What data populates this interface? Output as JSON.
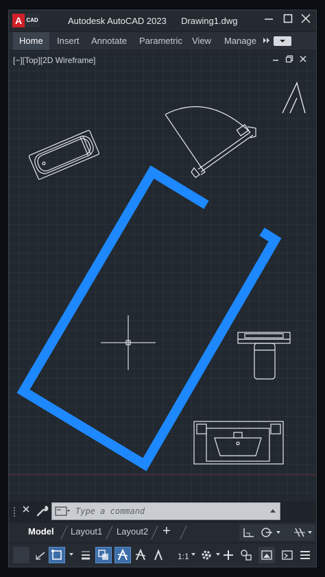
{
  "app": {
    "logo_letter": "A",
    "logo_text": "CAD",
    "title": "Autodesk AutoCAD 2023",
    "document": "Drawing1.dwg",
    "accent_color": "#1e88ff"
  },
  "ribbon": {
    "tabs": [
      {
        "label": "Home",
        "active": true
      },
      {
        "label": "Insert",
        "active": false
      },
      {
        "label": "Annotate",
        "active": false
      },
      {
        "label": "Parametric",
        "active": false
      },
      {
        "label": "View",
        "active": false
      },
      {
        "label": "Manage",
        "active": false
      }
    ],
    "more_icon": "double-chevron-right-icon"
  },
  "viewport": {
    "label": "[−][Top][2D Wireframe]",
    "controls": [
      "minimize-icon",
      "restore-icon",
      "close-icon"
    ]
  },
  "command": {
    "placeholder": "Type a command",
    "value": ""
  },
  "layouts": {
    "tabs": [
      {
        "label": "Model",
        "active": true
      },
      {
        "label": "Layout1",
        "active": false
      },
      {
        "label": "Layout2",
        "active": false
      }
    ],
    "add_label": "+"
  },
  "status": {
    "scale": "1:1",
    "icons": [
      "grid-icon",
      "ortho-icon",
      "selection-cycling-icon",
      "lineweight-icon",
      "transparency-icon",
      "annotation-scale-icon",
      "annotation-visibility-icon",
      "annotation-auto-icon",
      "settings-gear-icon",
      "add-icon",
      "isolate-icon",
      "hardware-accel-icon",
      "fullscreen-icon",
      "hamburger-menu-icon"
    ]
  }
}
